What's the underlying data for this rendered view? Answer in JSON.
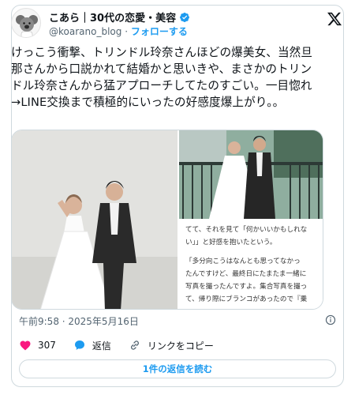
{
  "author": {
    "display_name": "こあら｜30代の恋愛・美容",
    "handle": "@koarano_blog",
    "separator": "·",
    "follow_label": "フォローする"
  },
  "tweet": {
    "text": "けっこう衝撃、トリンドル玲奈さんほどの爆美女、当然旦那さんから口説かれて結婚かと思いきや、まさかのトリンドル玲奈さんから猛アプローチしてたのすごい。一目惚れ→LINE交換まで積極的にいったの好感度爆上がり。。",
    "timestamp": "午前9:58 · 2025年5月16日"
  },
  "media": {
    "article_lines": [
      "てて、それを見て「何かいいかもしれな",
      "い」」と好感を抱いたという。",
      "",
      "「多分向こうはなんとも思ってなかっ",
      "たんですけど、最終日にたまたま一緒に",
      "写真を撮ったんですよ。集合写真を撮っ",
      "て、帰り際にブランコがあったので『乗"
    ]
  },
  "actions": {
    "likes_count": "307",
    "reply_label": "返信",
    "copy_link_label": "リンクをコピー"
  },
  "read_replies_label": "1件の返信を読む",
  "colors": {
    "accent": "#1d9bf0",
    "like": "#f91880",
    "text": "#0f1419",
    "muted": "#536471"
  }
}
